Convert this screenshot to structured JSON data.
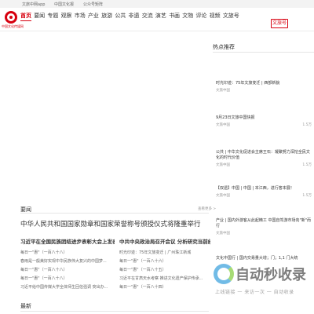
{
  "topbar": {
    "link1": "文旅中网app",
    "link2": "中国文化报",
    "link3": "公众号矩阵"
  },
  "logo": {
    "text": "中国文化传媒网"
  },
  "nav": {
    "items": [
      "首页",
      "要闻",
      "专题",
      "观察",
      "市场",
      "产业",
      "旅游",
      "公共",
      "非遗",
      "交流",
      "演艺",
      "书画",
      "文物",
      "评论",
      "视频",
      "文旅号"
    ],
    "active_index": 0
  },
  "header_buttons": {
    "red": "要闻",
    "outline": "文旅号"
  },
  "sidebar": {
    "title": "热点推荐",
    "items": [
      {
        "title": "时光印迹：75年文旅变迁 | 西部新貌",
        "source": "文旅中国",
        "views": ""
      },
      {
        "title": "9月23日文旅中国快报",
        "source": "文旅中国",
        "views": "1.5万"
      },
      {
        "title": "公共 | 中华文化促进会主席王石：凝聚努力深挖全民文化的时代价值",
        "source": "文旅中国",
        "views": "1.5万"
      },
      {
        "title": "【双遗】中国 | 中国 | 本江西，进行答本展！",
        "source": "文旅中国",
        "views": "1.5万"
      },
      {
        "title": "产业 | 国内外游客从此起精工 中国自驾游市场向\"新\"而行",
        "source": "文旅中国",
        "views": ""
      },
      {
        "title": "文化中国行 | 国内交易量大增；门；1,1 门大统",
        "source": "",
        "views": ""
      }
    ]
  },
  "news": {
    "section_title": "要闻",
    "more": "查看更多 >",
    "headline": "中华人民共和国国家勋章和国家荣誉称号颁授仪式将隆重举行",
    "left": {
      "title": "习近平在全国民族团结进步表彰大会上发表...",
      "lines": [
        "每日一\"惠\"（一百八十八）",
        "春雨是一般美好实现中华民族伟大复兴的中国梦...",
        "每日一\"惠\"（一百八十八）",
        "每日一\"惠\"（一百八十八）",
        "习近平给中国传媒大学全体师生回信强调 突出办..."
      ]
    },
    "right": {
      "title": "中共中央政治局召开会议 分析研究当前经济...",
      "lines": [
        "时光印迹：75年文旅变迁 | 广州珠江新城",
        "每日一\"惠\"（一百八十六）",
        "每日一\"惠\"（一百八十五）",
        "习近平在甘肃天水考察 推进文化遗产保护传承...",
        "每日一\"惠\"（一百八十四）"
      ]
    },
    "latest_title": "最新"
  },
  "watermark": {
    "big": "自动秒收录",
    "small": "上线链接 一 来访一次 一 自动收录"
  },
  "colors": {
    "brand_red": "#d7000f",
    "text": "#333333",
    "muted": "#999999"
  }
}
